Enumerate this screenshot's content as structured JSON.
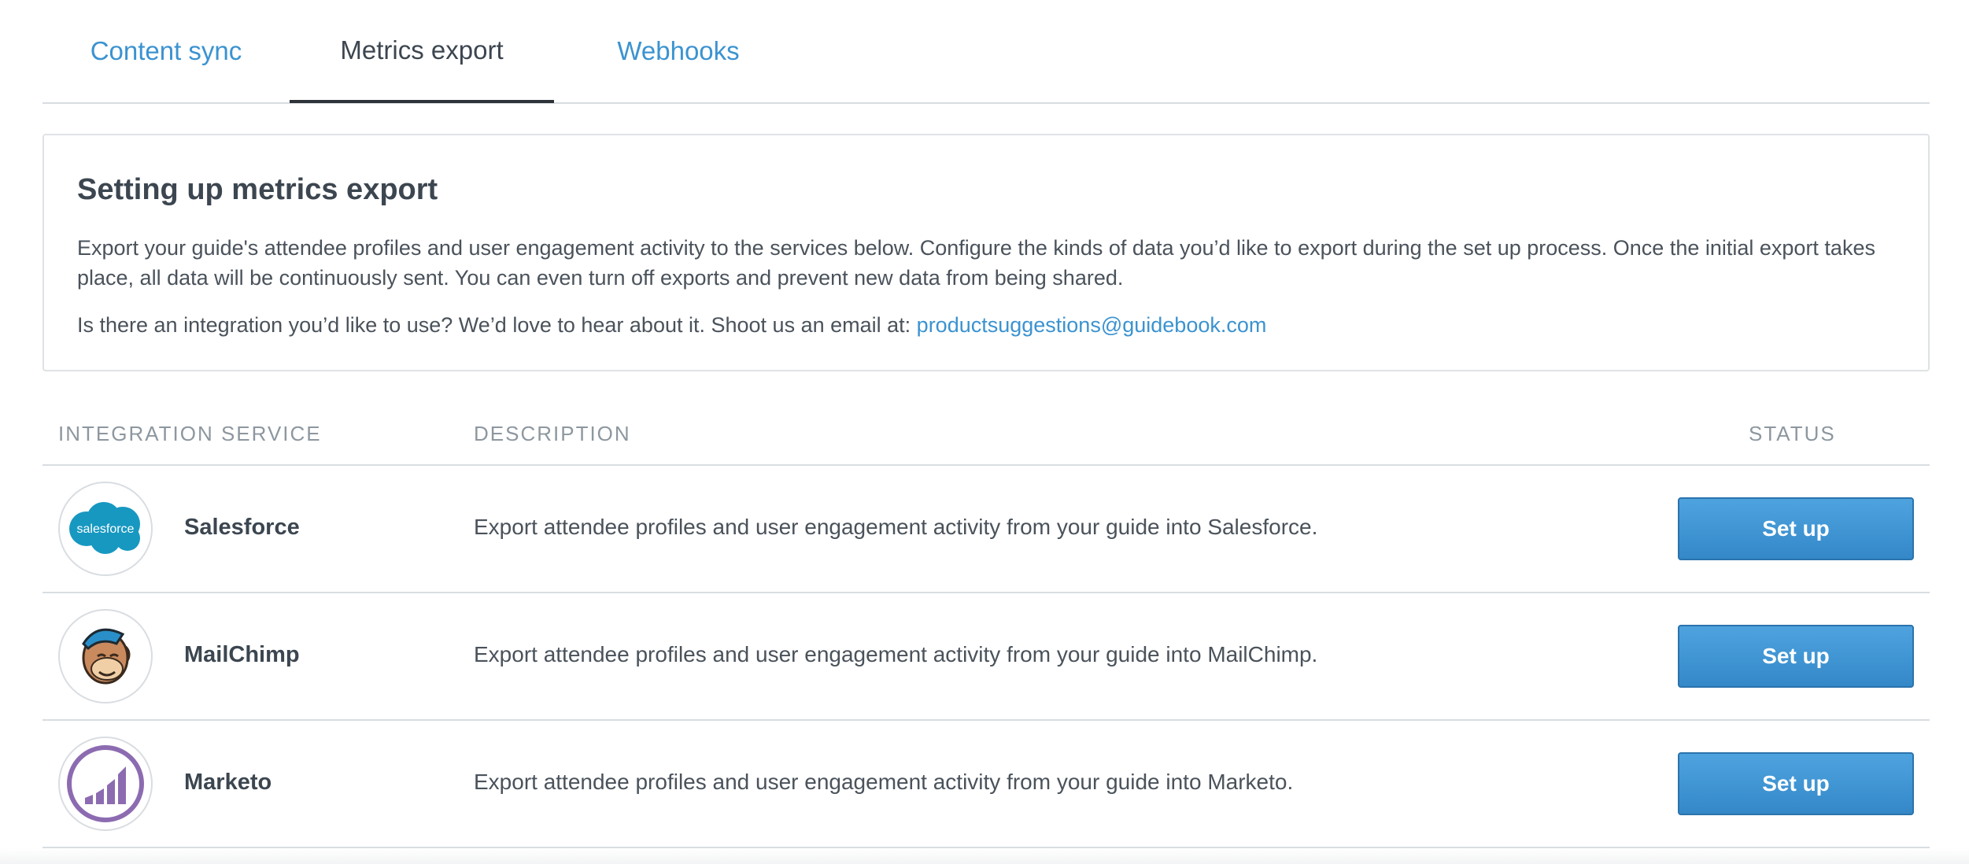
{
  "tabs": [
    {
      "label": "Content sync",
      "active": false
    },
    {
      "label": "Metrics export",
      "active": true
    },
    {
      "label": "Webhooks",
      "active": false
    }
  ],
  "info": {
    "title": "Setting up metrics export",
    "paragraph1": "Export your guide's attendee profiles and user engagement activity to the services below. Configure the kinds of data you’d like to export during the set up process. Once the initial export takes place, all data will be continuously sent. You can even turn off exports and prevent new data from being shared.",
    "paragraph2": "Is there an integration you’d like to use? We’d love to hear about it. Shoot us an email at:",
    "email": "productsuggestions@guidebook.com"
  },
  "table": {
    "headers": {
      "service": "Integration Service",
      "description": "Description",
      "status": "Status"
    },
    "rows": [
      {
        "name": "Salesforce",
        "description": "Export attendee profiles and user engagement activity from your guide into Salesforce.",
        "button_label": "Set up",
        "logo_icon": "salesforce-logo-icon",
        "logo_text": "salesforce"
      },
      {
        "name": "MailChimp",
        "description": "Export attendee profiles and user engagement activity from your guide into MailChimp.",
        "button_label": "Set up",
        "logo_icon": "mailchimp-logo-icon"
      },
      {
        "name": "Marketo",
        "description": "Export attendee profiles and user engagement activity from your guide into Marketo.",
        "button_label": "Set up",
        "logo_icon": "marketo-logo-icon"
      }
    ]
  },
  "colors": {
    "link": "#3b93d0",
    "button": "#3d92d2",
    "salesforce": "#1798c1",
    "marketo": "#8c6bb1"
  }
}
